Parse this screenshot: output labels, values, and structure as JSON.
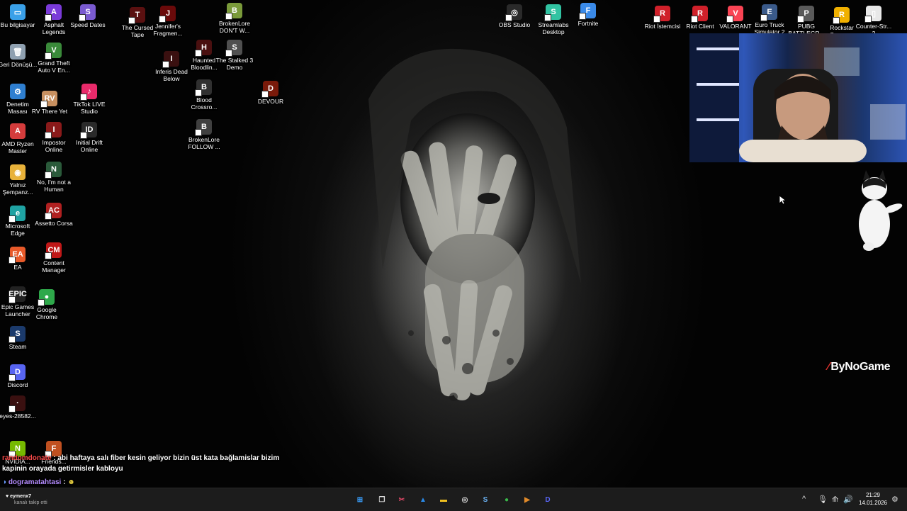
{
  "desktop_icons_left": [
    {
      "label": "Bu bilgisayar",
      "color": "#3aa0e8",
      "glyph": "▭"
    },
    {
      "label": "Geri Dönüşü...",
      "color": "#8fa0b0",
      "glyph": "🗑"
    },
    {
      "label": "Denetim Masası",
      "color": "#2f7fd0",
      "glyph": "⚙"
    },
    {
      "label": "AMD Ryzen Master",
      "color": "#d43c3c",
      "glyph": "A"
    },
    {
      "label": "Yalnız Şempanz...",
      "color": "#e8b23a",
      "glyph": "◉"
    },
    {
      "label": "Microsoft Edge",
      "color": "#1fa3a3",
      "glyph": "e"
    },
    {
      "label": "EA",
      "color": "#e85a2a",
      "glyph": "EA"
    },
    {
      "label": "Epic Games Launcher",
      "color": "#222",
      "glyph": "EPIC"
    },
    {
      "label": "Steam",
      "color": "#1b3a6b",
      "glyph": "S"
    },
    {
      "label": "Discord",
      "color": "#5865f2",
      "glyph": "D"
    },
    {
      "label": "eyes-28582...",
      "color": "#3a1010",
      "glyph": "·"
    }
  ],
  "desktop_icons_col2": [
    {
      "label": "Asphalt Legends",
      "color": "#7a3ad8",
      "glyph": "A"
    },
    {
      "label": "Grand Theft Auto V En...",
      "color": "#3a8a3a",
      "glyph": "V"
    },
    {
      "label": "RV There Yet",
      "color": "#c89060",
      "glyph": "RV"
    },
    {
      "label": "Impostor Online",
      "color": "#8a1a1a",
      "glyph": "I"
    },
    {
      "label": "No, I'm not a Human",
      "color": "#2a5a3a",
      "glyph": "N"
    },
    {
      "label": "Assetto Corsa",
      "color": "#b02020",
      "glyph": "AC"
    },
    {
      "label": "Content Manager",
      "color": "#c01818",
      "glyph": "CM"
    },
    {
      "label": "Google Chrome",
      "color": "#2ea84a",
      "glyph": "●"
    }
  ],
  "desktop_icons_col3": [
    {
      "label": "Speed Dates",
      "color": "#7a5ad0",
      "glyph": "S"
    },
    {
      "label": "TikTok LIVE Studio",
      "color": "#e82a6a",
      "glyph": "♪"
    },
    {
      "label": "Initial Drift Online",
      "color": "#2a2a2a",
      "glyph": "ID"
    }
  ],
  "desktop_icons_games": [
    {
      "label": "The Cursed Tape",
      "color": "#5a1010",
      "glyph": "T"
    },
    {
      "label": "Jennifer's Fragmen...",
      "color": "#6a0a0a",
      "glyph": "J"
    },
    {
      "label": "Inferis Dead Below",
      "color": "#3a1010",
      "glyph": "I"
    },
    {
      "label": "Haunted Bloodlin...",
      "color": "#4a1010",
      "glyph": "H"
    },
    {
      "label": "Blood Crossro...",
      "color": "#303030",
      "glyph": "B"
    },
    {
      "label": "BrokenLore FOLLOW ...",
      "color": "#404040",
      "glyph": "B"
    },
    {
      "label": "BrokenLore DON'T W...",
      "color": "#7a9a3a",
      "glyph": "B"
    },
    {
      "label": "The Stalked 3 Demo",
      "color": "#505050",
      "glyph": "S"
    },
    {
      "label": "DEVOUR",
      "color": "#7a1a0a",
      "glyph": "D"
    }
  ],
  "desktop_icons_top": [
    {
      "label": "OBS Studio",
      "color": "#2a2a2a",
      "glyph": "◎"
    },
    {
      "label": "Streamlabs Desktop",
      "color": "#31c3a2",
      "glyph": "S"
    },
    {
      "label": "Fortnite",
      "color": "#3a8ae8",
      "glyph": "F"
    },
    {
      "label": "Riot İstemcisi",
      "color": "#d0202a",
      "glyph": "R"
    },
    {
      "label": "Riot Client",
      "color": "#d0202a",
      "glyph": "R"
    },
    {
      "label": "VALORANT",
      "color": "#fa4454",
      "glyph": "V"
    },
    {
      "label": "Euro Truck Simulator 2",
      "color": "#3a5a8a",
      "glyph": "E"
    },
    {
      "label": "PUBG BATTLEGR...",
      "color": "#5a5a5a",
      "glyph": "P"
    },
    {
      "label": "Rockstar Games...",
      "color": "#f0b000",
      "glyph": "R"
    },
    {
      "label": "Counter-Str... 2",
      "color": "#e8e8e8",
      "glyph": "▯"
    }
  ],
  "bottom_icons": [
    {
      "label": "NVIDIA...",
      "color": "#76b900",
      "glyph": "N"
    },
    {
      "label": "Friends...",
      "color": "#c05020",
      "glyph": "F"
    }
  ],
  "overlay": {
    "brand_mark": "⁄",
    "brand": "ByNoGame"
  },
  "chat": {
    "line1_user": "randomdonate",
    "line1_msg": ": abi haftaya salı fiber kesin geliyor bizin üst kata bağlamislar bizim",
    "line2_msg": "kapinin orayada getirmisler kabloyu",
    "line3_user": "dogramatahtasi",
    "line3_msg": ":"
  },
  "taskbar": {
    "follower_name": "eymenx7",
    "follower_text": "kanalı takip etti",
    "time": "21:29",
    "date": "14.01.2026",
    "apps": [
      {
        "name": "start",
        "color": "#3aa0ff",
        "glyph": "⊞"
      },
      {
        "name": "task-view",
        "color": "#dddddd",
        "glyph": "❐"
      },
      {
        "name": "snipping",
        "color": "#e84a6a",
        "glyph": "✂"
      },
      {
        "name": "photos",
        "color": "#2a8ae8",
        "glyph": "▲"
      },
      {
        "name": "file-explorer",
        "color": "#f0c020",
        "glyph": "▬"
      },
      {
        "name": "obs",
        "color": "#dddddd",
        "glyph": "◎"
      },
      {
        "name": "steam",
        "color": "#6ab0f0",
        "glyph": "S"
      },
      {
        "name": "chrome",
        "color": "#3ab84a",
        "glyph": "●"
      },
      {
        "name": "media",
        "color": "#e08a2a",
        "glyph": "▶"
      },
      {
        "name": "discord",
        "color": "#5865f2",
        "glyph": "D"
      }
    ],
    "tray": [
      "^",
      "🎙",
      "⟰",
      "🔊",
      "⚙"
    ]
  }
}
